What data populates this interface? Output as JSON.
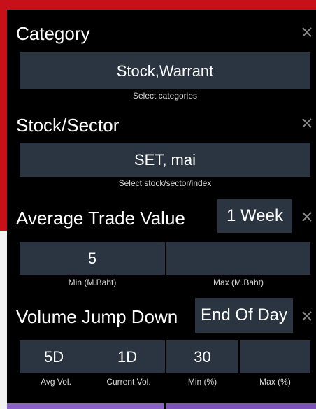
{
  "category": {
    "title": "Category",
    "value": "Stock,Warrant",
    "caption": "Select categories"
  },
  "stock_sector": {
    "title": "Stock/Sector",
    "value": "SET, mai",
    "caption": "Select stock/sector/index"
  },
  "average_trade_value": {
    "title": "Average Trade Value",
    "period": "1 Week",
    "min_value": "5",
    "max_value": "",
    "min_caption": "Min (M.Baht)",
    "max_caption": "Max (M.Baht)"
  },
  "volume_jump_down": {
    "title": "Volume Jump Down",
    "period": "End Of Day",
    "avg_vol_value": "5D",
    "current_vol_value": "1D",
    "min_value": "30",
    "max_value": "",
    "avg_vol_caption": "Avg Vol.",
    "current_vol_caption": "Current Vol.",
    "min_caption": "Min (%)",
    "max_caption": "Max (%)"
  },
  "icons": {
    "close": "close-icon"
  },
  "colors": {
    "background": "#000000",
    "field": "#2b3441",
    "accent_red": "#c8101a",
    "button_purple": "#7d55b8"
  }
}
